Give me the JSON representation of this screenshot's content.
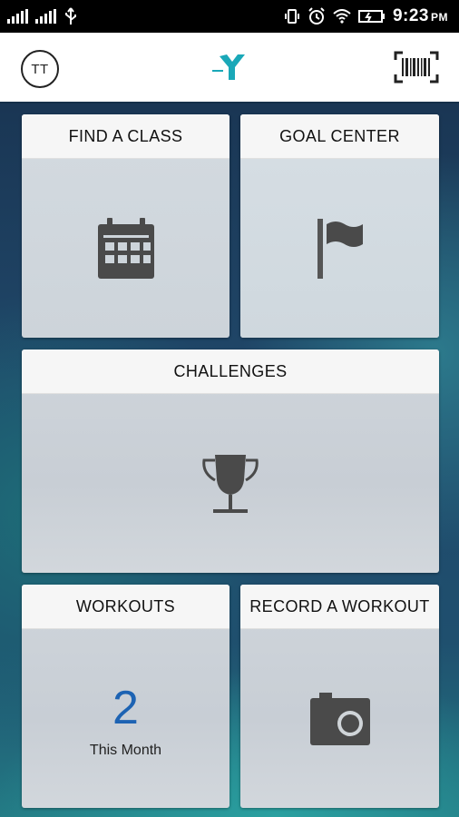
{
  "status_bar": {
    "time": "9:23",
    "ampm": "PM"
  },
  "app_bar": {
    "avatar_initials": "TT",
    "logo_icon": "ymca-logo-icon",
    "barcode_icon": "barcode-icon"
  },
  "tiles": {
    "find_class": {
      "label": "FIND A CLASS",
      "icon": "calendar-icon"
    },
    "goal_center": {
      "label": "GOAL CENTER",
      "icon": "flag-icon"
    },
    "challenges": {
      "label": "CHALLENGES",
      "icon": "trophy-icon"
    },
    "workouts": {
      "label": "WORKOUTS",
      "count": "2",
      "count_label": "This Month"
    },
    "record_workout": {
      "label": "RECORD A WORKOUT",
      "icon": "camera-icon"
    }
  },
  "colors": {
    "accent_blue": "#1d63b3",
    "ymca_teal": "#1aa8b8",
    "icon_gray": "#4a4a4a"
  }
}
